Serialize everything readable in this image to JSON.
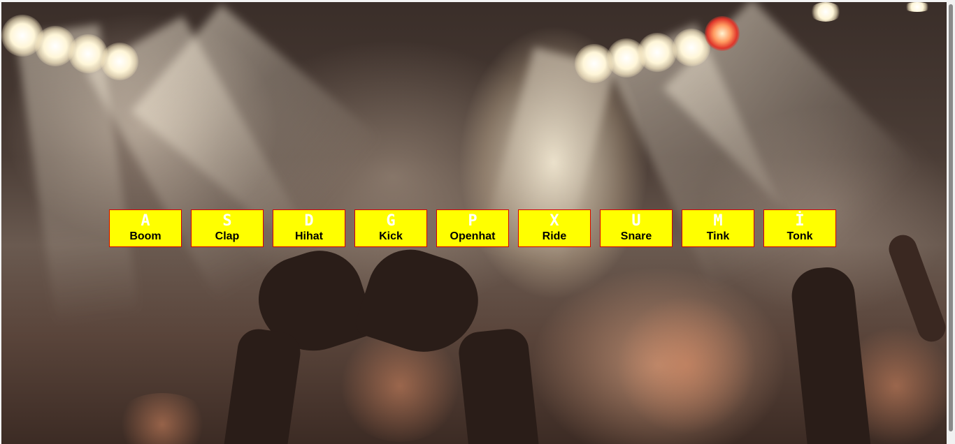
{
  "drum_kit": {
    "keys": [
      {
        "key": "A",
        "sound": "Boom"
      },
      {
        "key": "S",
        "sound": "Clap"
      },
      {
        "key": "D",
        "sound": "Hihat"
      },
      {
        "key": "G",
        "sound": "Kick"
      },
      {
        "key": "P",
        "sound": "Openhat"
      },
      {
        "key": "X",
        "sound": "Ride"
      },
      {
        "key": "U",
        "sound": "Snare"
      },
      {
        "key": "M",
        "sound": "Tink"
      },
      {
        "key": "İ",
        "sound": "Tonk"
      }
    ]
  },
  "colors": {
    "key_background": "#ffff00",
    "key_border": "#d40000",
    "key_letter": "#ffffff",
    "sound_label": "#000000"
  }
}
